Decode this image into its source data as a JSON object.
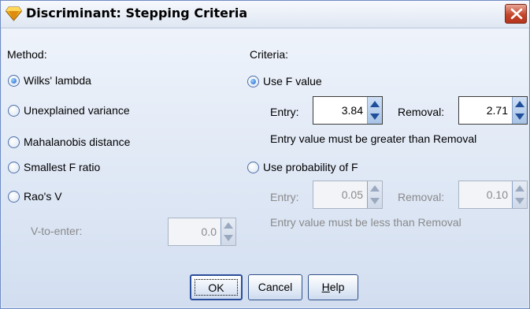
{
  "window": {
    "title": "Discriminant: Stepping Criteria"
  },
  "method": {
    "label": "Method:",
    "options": [
      {
        "label": "Wilks' lambda",
        "selected": true
      },
      {
        "label": "Unexplained variance",
        "selected": false
      },
      {
        "label": "Mahalanobis distance",
        "selected": false
      },
      {
        "label": "Smallest F ratio",
        "selected": false
      },
      {
        "label": "Rao's V",
        "selected": false
      }
    ],
    "v_to_enter": {
      "label": "V-to-enter:",
      "value": "0.0",
      "enabled": false
    }
  },
  "criteria": {
    "label": "Criteria:",
    "use_f": {
      "label": "Use F value",
      "selected": true,
      "entry_label": "Entry:",
      "entry_value": "3.84",
      "removal_label": "Removal:",
      "removal_value": "2.71",
      "note": "Entry value must be greater than Removal"
    },
    "use_prob": {
      "label": "Use probability of F",
      "selected": false,
      "entry_label": "Entry:",
      "entry_value": "0.05",
      "removal_label": "Removal:",
      "removal_value": "0.10",
      "note": "Entry value must be less than Removal"
    }
  },
  "buttons": {
    "ok": "OK",
    "cancel": "Cancel",
    "help_first": "H",
    "help_rest": "elp"
  },
  "colors": {
    "accent": "#1560c9",
    "disabled_text": "#8a8a8a",
    "close": "#c5452b"
  }
}
